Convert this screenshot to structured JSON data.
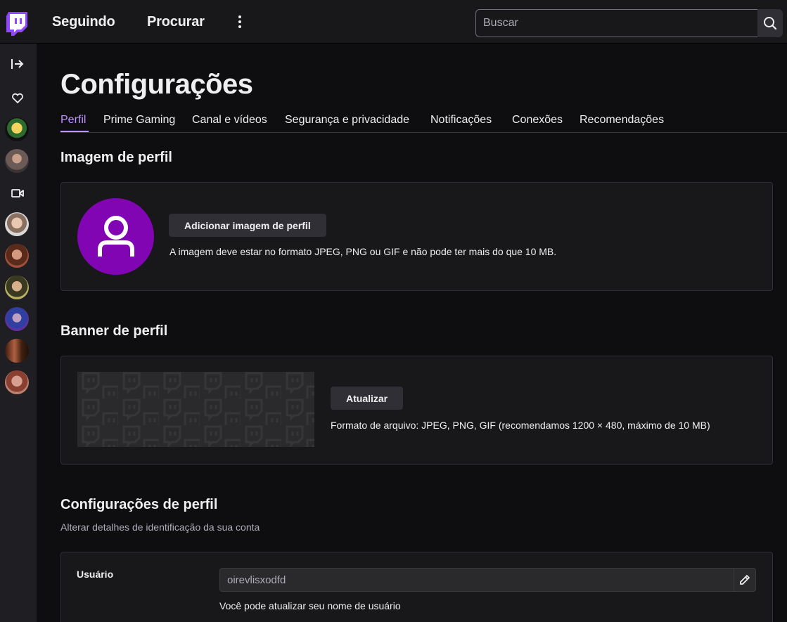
{
  "nav": {
    "following": "Seguindo",
    "browse": "Procurar",
    "search_placeholder": "Buscar"
  },
  "sidebar": {
    "icons": [
      "expand-arrow-icon",
      "heart-icon",
      "camera-icon"
    ],
    "avatars": 8
  },
  "page": {
    "title": "Configurações",
    "tabs": [
      {
        "label": "Perfil",
        "active": true
      },
      {
        "label": "Prime Gaming"
      },
      {
        "label": "Canal e vídeos"
      },
      {
        "label": "Segurança e privacidade"
      },
      {
        "label": "Notificações"
      },
      {
        "label": "Conexões"
      },
      {
        "label": "Recomendações"
      }
    ]
  },
  "profile_image": {
    "title": "Imagem de perfil",
    "button": "Adicionar imagem de perfil",
    "hint": "A imagem deve estar no formato JPEG, PNG ou GIF e não pode ter mais do que 10 MB."
  },
  "banner": {
    "title": "Banner de perfil",
    "button": "Atualizar",
    "hint": "Formato de arquivo: JPEG, PNG, GIF (recomendamos 1200 × 480, máximo de 10 MB)"
  },
  "profile_settings": {
    "title": "Configurações de perfil",
    "subtitle": "Alterar detalhes de identificação da sua conta",
    "username_label": "Usuário",
    "username_value": "oirevlisxodfd",
    "username_hint": "Você pode atualizar seu nome de usuário"
  },
  "colors": {
    "accent": "#bf94ff",
    "brand": "#9147ff",
    "avatar_bg": "#8205b4"
  }
}
